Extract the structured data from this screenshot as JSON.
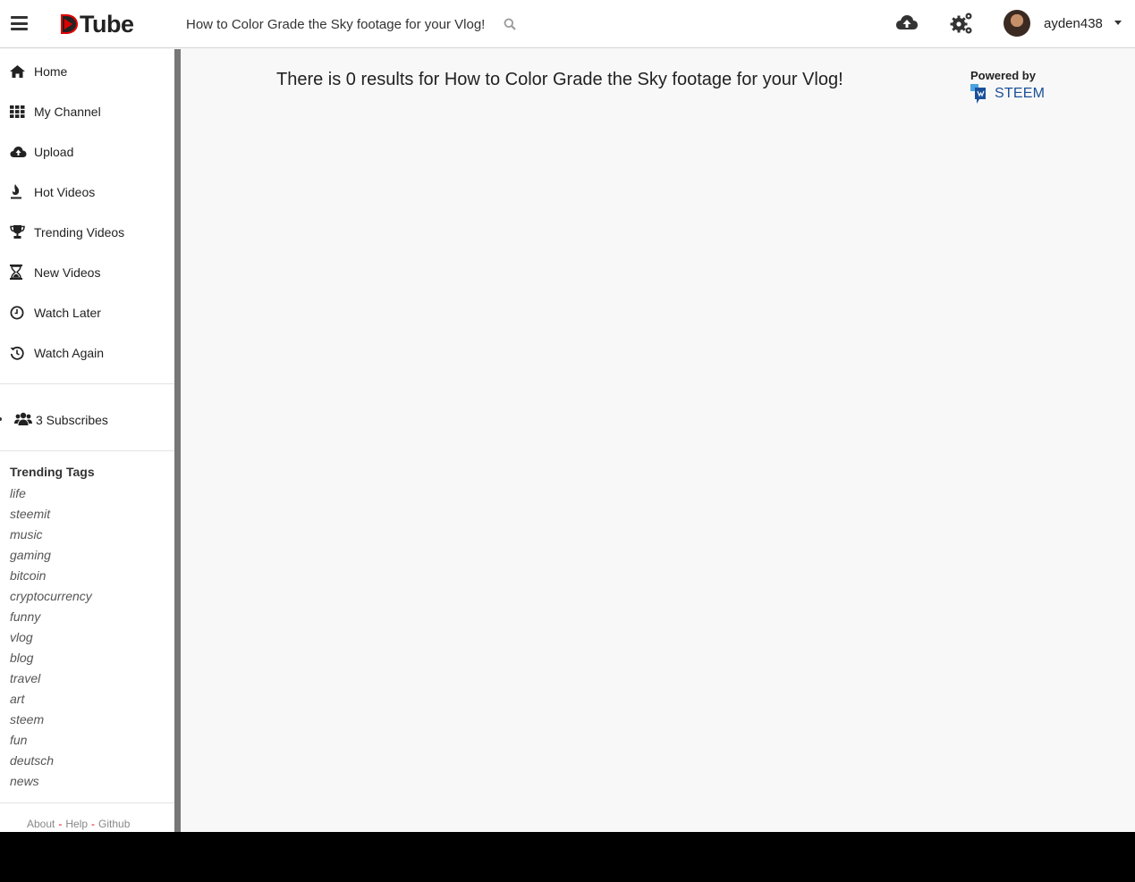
{
  "header": {
    "logo_text": "Tube",
    "search_value": "How to Color Grade the Sky footage for your Vlog!",
    "search_placeholder": "Search",
    "username": "ayden438"
  },
  "sidebar": {
    "items": [
      {
        "label": "Home",
        "icon": "home-icon"
      },
      {
        "label": "My Channel",
        "icon": "grid-icon"
      },
      {
        "label": "Upload",
        "icon": "cloud-upload-icon"
      },
      {
        "label": "Hot Videos",
        "icon": "fire-icon"
      },
      {
        "label": "Trending Videos",
        "icon": "trophy-icon"
      },
      {
        "label": "New Videos",
        "icon": "hourglass-icon"
      },
      {
        "label": "Watch Later",
        "icon": "clock-icon"
      },
      {
        "label": "Watch Again",
        "icon": "history-icon"
      }
    ],
    "subscribes_label": "3 Subscribes",
    "trending_title": "Trending Tags",
    "tags": [
      "life",
      "steemit",
      "music",
      "gaming",
      "bitcoin",
      "cryptocurrency",
      "funny",
      "vlog",
      "blog",
      "travel",
      "art",
      "steem",
      "fun",
      "deutsch",
      "news"
    ],
    "footer": {
      "about": "About",
      "help": "Help",
      "github": "Github",
      "separator": "-"
    }
  },
  "main": {
    "result_text": "There is 0 results for How to Color Grade the Sky footage for your Vlog!",
    "powered_by": "Powered by",
    "steem_label": "STEEM"
  },
  "colors": {
    "brand_red": "#e00000",
    "steem_blue": "#1a5099",
    "sidebar_edge": "#777777"
  }
}
